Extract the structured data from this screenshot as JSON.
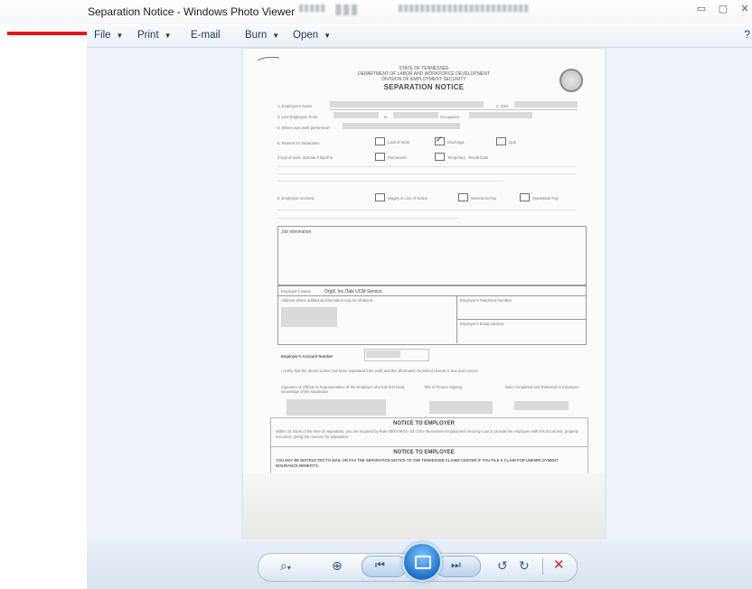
{
  "window": {
    "title": "Separation Notice - Windows Photo Viewer"
  },
  "menu": {
    "file": "File",
    "print": "Print",
    "email": "E-mail",
    "burn": "Burn",
    "open": "Open"
  },
  "document": {
    "header1": "STATE OF TENNESSEE",
    "header2": "DEPARTMENT OF LABOR AND WORKFORCE DEVELOPMENT",
    "header3": "DIVISION OF EMPLOYMENT SECURITY",
    "title": "SEPARATION NOTICE",
    "row1_label": "1. Employee's Name",
    "row1_ssn": "2. SSN",
    "row2_label": "3. Last Employed: From",
    "row2_to": "to",
    "row2_occupation": "Occupation",
    "row3_label": "4. Where was work performed?",
    "row4_label": "5. Reason for Separation",
    "reason_lack": "Lack of Work",
    "reason_discharge": "Discharge",
    "reason_quit": "Quit",
    "layoff_label": "If lack of work, indicate if layoff is",
    "layoff_permanent": "Permanent",
    "layoff_temporary": "Temporary - Recall Date",
    "row6_label": "6. Employee received",
    "received_pay": "Wages in Lieu of Notice",
    "received_severance": "Severance Pay",
    "received_separation": "Separation Pay",
    "job_elimination": "Job elimination",
    "employer_name_label": "Employer's Name",
    "employer_name": "Orgill, Inc./Talx UCM Service",
    "employer_address_label": "Address where additional information may be obtained",
    "employer_phone_label": "Employer's Telephone Number",
    "employer_email_label": "Employer's Email Address",
    "account_label": "Employer's Account Number",
    "certify_text": "I certify that the above worker has been separated from work and the information furnished hereon is true and correct.",
    "signature_label": "Signature of Official or Representative of the Employer who has first hand knowledge of the separation",
    "title_signing_label": "Title of Person Signing",
    "date_label": "Date Completed and Released to Employee",
    "notice_employer": "NOTICE TO EMPLOYER",
    "notice_employer_text": "Within 24 hours of the time of separation, you are required by Rule 0800-09-01-.03 of the Tennessee Employment Security Law to provide the employee with this document, properly executed, giving the reasons for separation.",
    "notice_employee": "NOTICE TO EMPLOYEE",
    "notice_employee_text": "YOU MAY BE INSTRUCTED TO MAIL OR FAX THE SEPARATION NOTICE TO THE TENNESSEE CLAIMS CENTER IF YOU FILE A CLAIM FOR UNEMPLOYMENT INSURANCE BENEFITS."
  },
  "toolbar": {
    "zoom_icon": "magnifier-icon",
    "actual_size_icon": "actual-size-icon",
    "previous_icon": "previous-icon",
    "slideshow_icon": "slideshow-icon",
    "next_icon": "next-icon",
    "rotate_ccw_icon": "rotate-ccw-icon",
    "rotate_cw_icon": "rotate-cw-icon",
    "delete_icon": "delete-icon"
  },
  "colors": {
    "annotation_arrow": "#e8141b",
    "menu_text": "#1f3b63",
    "delete": "#d02020"
  }
}
